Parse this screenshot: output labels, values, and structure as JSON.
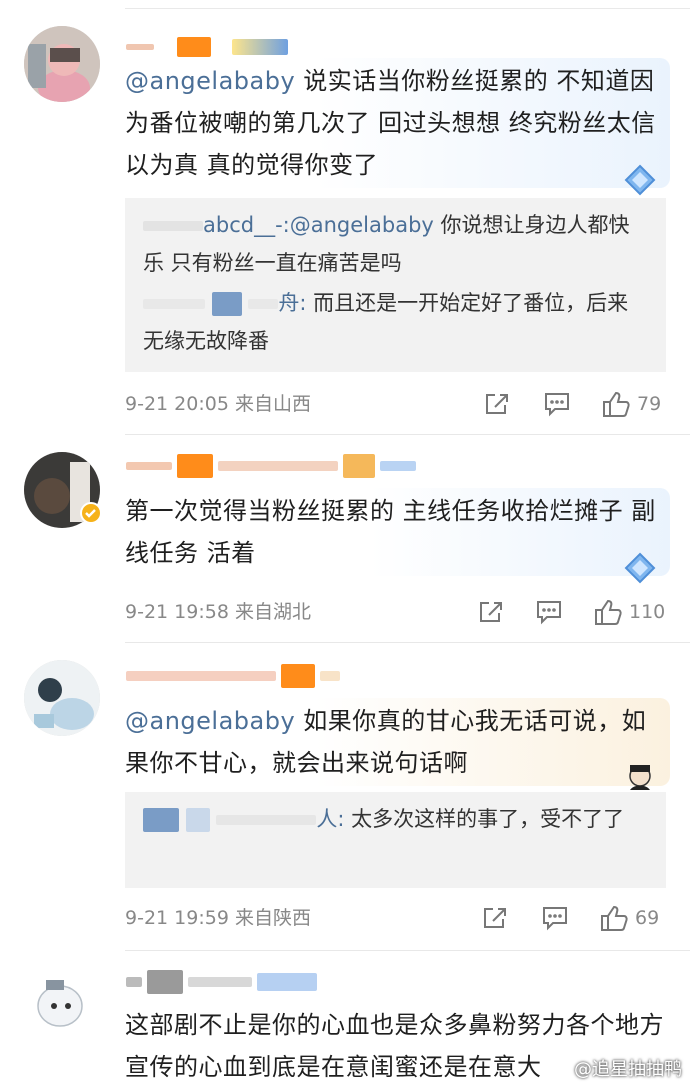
{
  "comments": [
    {
      "text_mention": "@angelababy",
      "text_body": " 说实话当你粉丝挺累的 不知道因为番位被嘲的第几次了 回过头想想 终究粉丝太信以为真 真的觉得你变了",
      "replies": [
        {
          "name": "abcd__-:",
          "mention": "@angelababy",
          "text": " 你说想让身边人都快乐 只有粉丝一直在痛苦是吗"
        },
        {
          "name": "舟:",
          "mention": "",
          "text": " 而且还是一开始定好了番位，后来无缘无故降番"
        }
      ],
      "date": "9-21 20:05",
      "location": "来自山西",
      "likes": "79"
    },
    {
      "text_mention": "",
      "text_body": "第一次觉得当粉丝挺累的 主线任务收拾烂摊子 副线任务 活着",
      "replies": [],
      "date": "9-21 19:58",
      "location": "来自湖北",
      "likes": "110"
    },
    {
      "text_mention": "@angelababy",
      "text_body": " 如果你真的甘心我无话可说，如果你不甘心，就会出来说句话啊",
      "replies": [
        {
          "name": "人:",
          "mention": "",
          "text": " 太多次这样的事了，受不了了"
        }
      ],
      "date": "9-21 19:59",
      "location": "来自陕西",
      "likes": "69"
    },
    {
      "text_mention": "",
      "text_body": "这部剧不止是你的心血也是众多鼻粉努力各个地方宣传的心血到底是在意闺蜜还是在意大",
      "replies": [],
      "date": "",
      "location": "",
      "likes": ""
    }
  ],
  "icons": [
    "share-icon",
    "comment-icon",
    "like-icon",
    "diamond-badge-icon",
    "verified-icon"
  ],
  "colors": {
    "mention": "#4b6f97",
    "meta": "#888888",
    "reply_bg": "#f2f2f2",
    "orange": "#ff8c1a",
    "blue": "#6fa0e0"
  },
  "watermark": "@追星抽抽鸭"
}
